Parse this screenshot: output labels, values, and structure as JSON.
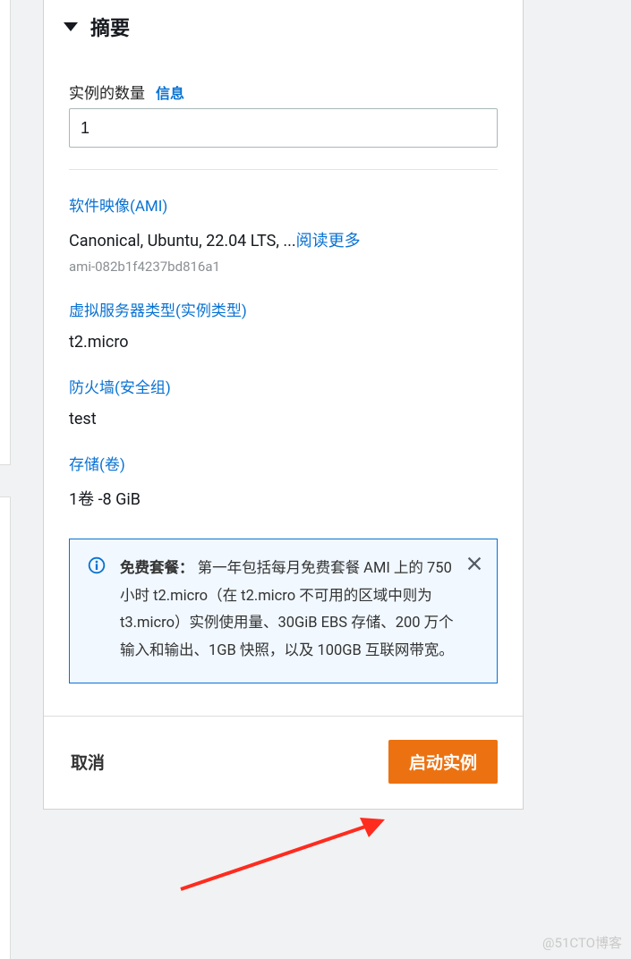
{
  "summary": {
    "title": "摘要",
    "instance_count_label": "实例的数量",
    "info_link": "信息",
    "instance_count_value": "1",
    "ami_section": "软件映像(AMI)",
    "ami_name": "Canonical, Ubuntu, 22.04 LTS, ...",
    "read_more": "阅读更多",
    "ami_id": "ami-082b1f4237bd816a1",
    "instance_type_section": "虚拟服务器类型(实例类型)",
    "instance_type_value": "t2.micro",
    "security_group_section": "防火墙(安全组)",
    "security_group_value": "test",
    "storage_section": "存储(卷)",
    "storage_value": "1卷 -8 GiB",
    "callout_title": "免费套餐：",
    "callout_text": "第一年包括每月免费套餐 AMI 上的 750 小时 t2.micro（在 t2.micro 不可用的区域中则为 t3.micro）实例使用量、30GiB EBS 存储、200 万个输入和输出、1GB 快照，以及 100GB 互联网带宽。"
  },
  "footer": {
    "cancel_label": "取消",
    "launch_label": "启动实例"
  },
  "watermark": "@51CTO博客"
}
